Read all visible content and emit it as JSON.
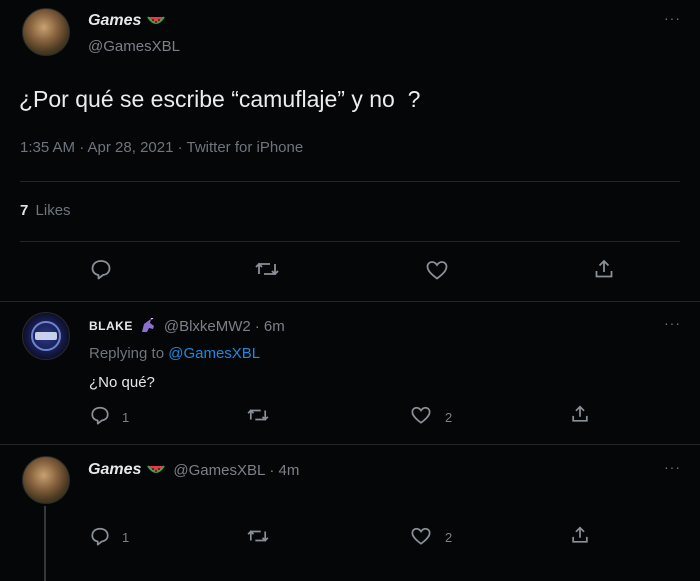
{
  "main_tweet": {
    "author_name": "Games",
    "author_handle": "@GamesXBL",
    "text": "¿Por qué se escribe “camuflaje” y no  ?",
    "meta": "1:35 AM · Apr 28, 2021 · Twitter for iPhone",
    "likes_count": "7",
    "likes_label": "Likes",
    "name_emoji_icon": "watermelon-icon"
  },
  "reply1": {
    "author_name": "BLAKE",
    "author_handle": "@BlxkeMW2",
    "time": "· 6m",
    "replying_prefix": "Replying to",
    "replying_handle": "@GamesXBL",
    "text": "¿No qué?",
    "reply_count": "1",
    "like_count": "2",
    "name_emoji_icon": "unicorn-icon"
  },
  "reply2": {
    "author_name": "Games",
    "author_handle": "@GamesXBL",
    "time": "· 4m",
    "reply_count": "1",
    "like_count": "2",
    "name_emoji_icon": "watermelon-icon"
  },
  "colors": {
    "background": "#050607",
    "link": "#1d8ae0",
    "muted": "#6e757c",
    "divider": "#22272b"
  }
}
